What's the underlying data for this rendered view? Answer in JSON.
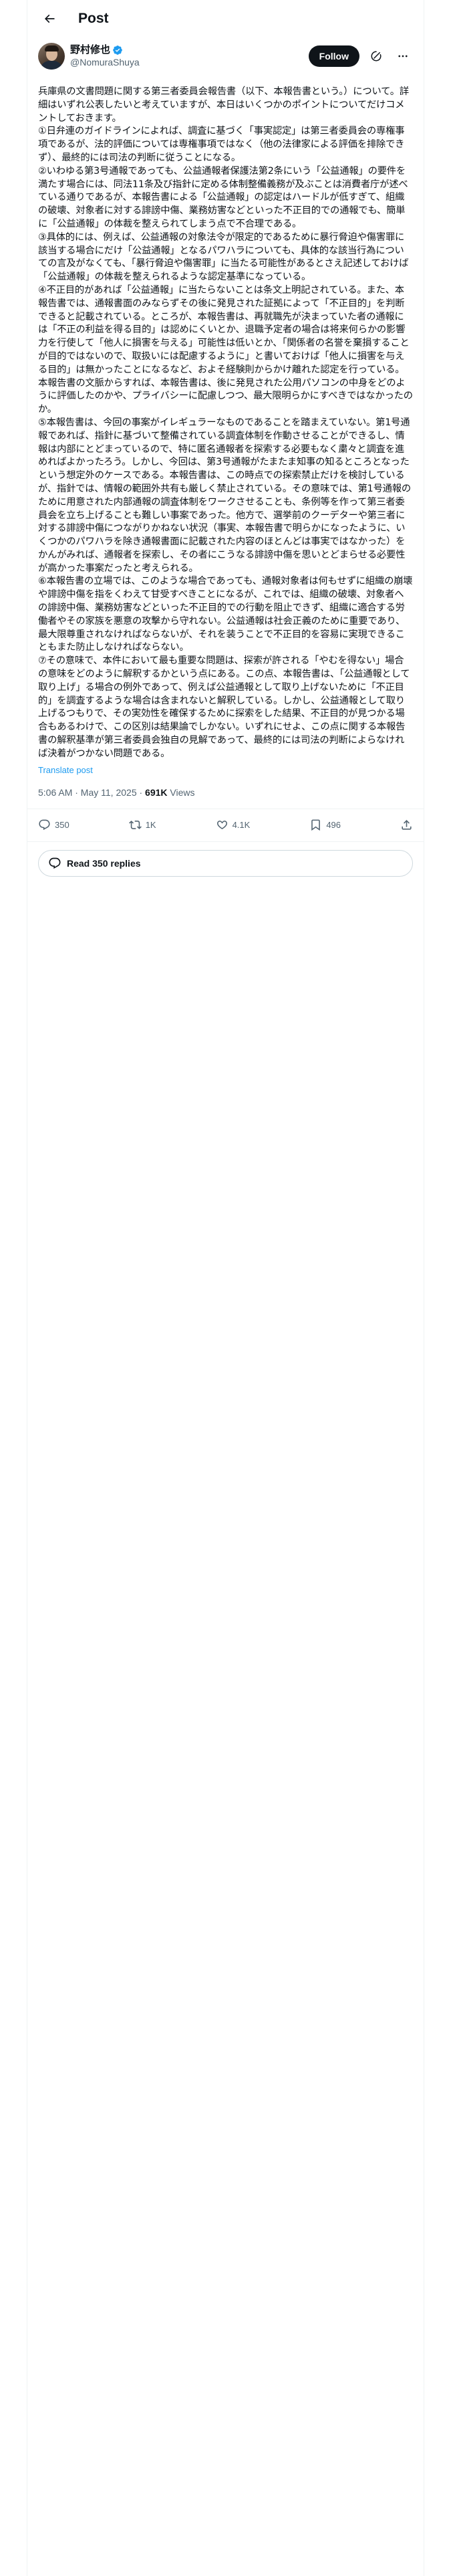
{
  "header": {
    "title": "Post"
  },
  "author": {
    "display_name": "野村修也",
    "handle": "@NomuraShuya",
    "follow_label": "Follow"
  },
  "post": {
    "text": "兵庫県の文書問題に関する第三者委員会報告書（以下、本報告書という。）について。詳細はいずれ公表したいと考えていますが、本日はいくつかのポイントについてだけコメントしておきます。\n①日弁連のガイドラインによれば、調査に基づく「事実認定」は第三者委員会の専権事項であるが、法的評価については専権事項ではなく（他の法律家による評価を排除できず）、最終的には司法の判断に従うことになる。\n②いわゆる第3号通報であっても、公益通報者保護法第2条にいう「公益通報」の要件を満たす場合には、同法11条及び指針に定める体制整備義務が及ぶことは消費者庁が述べている通りであるが、本報告書による「公益通報」の認定はハードルが低すぎて、組織の破壊、対象者に対する誹謗中傷、業務妨害などといった不正目的での通報でも、簡単に「公益通報」の体裁を整えられてしまう点で不合理である。\n③具体的には、例えば、公益通報の対象法令が限定的であるために暴行脅迫や傷害罪に該当する場合にだけ「公益通報」となるパワハラについても、具体的な該当行為についての言及がなくても、「暴行脅迫や傷害罪」に当たる可能性があるとさえ記述しておけば「公益通報」の体裁を整えられるような認定基準になっている。\n④不正目的があれば「公益通報」に当たらないことは条文上明記されている。また、本報告書では、通報書面のみならずその後に発見された証拠によって「不正目的」を判断できると記載されている。ところが、本報告書は、再就職先が決まっていた者の通報には「不正の利益を得る目的」は認めにくいとか、退職予定者の場合は将来何らかの影響力を行使して「他人に損害を与える」可能性は低いとか、「関係者の名誉を棄損することが目的ではないので、取扱いには配慮するように」と書いておけば「他人に損害を与える目的」は無かったことになるなど、およそ経験則からかけ離れた認定を行っている。本報告書の文脈からすれば、本報告書は、後に発見された公用パソコンの中身をどのように評価したのかや、プライバシーに配慮しつつ、最大限明らかにすべきではなかったのか。\n⑤本報告書は、今回の事案がイレギュラーなものであることを踏まえていない。第1号通報であれば、指針に基づいて整備されている調査体制を作動させることができるし、情報は内部にとどまっているので、特に匿名通報者を探索する必要もなく粛々と調査を進めればよかったろう。しかし、今回は、第3号通報がたまたま知事の知るところとなったという想定外のケースである。本報告書は、この時点での探索禁止だけを検討しているが、指針では、情報の範囲外共有も厳しく禁止されている。その意味では、第1号通報のために用意された内部通報の調査体制をワークさせることも、条例等を作って第三者委員会を立ち上げることも難しい事案であった。他方で、選挙前のクーデターや第三者に対する誹謗中傷につながりかねない状況（事実、本報告書で明らかになったように、いくつかのパワハラを除き通報書面に記載された内容のほとんどは事実ではなかった）をかんがみれば、通報者を探索し、その者にこうなる誹謗中傷を思いとどまらせる必要性が高かった事案だったと考えられる。\n⑥本報告書の立場では、このような場合であっても、通報対象者は何もせずに組織の崩壊や誹謗中傷を指をくわえて甘受すべきことになるが、これでは、組織の破壊、対象者への誹謗中傷、業務妨害などといった不正目的での行動を阻止できず、組織に適合する労働者やその家族を悪意の攻撃から守れない。公益通報は社会正義のために重要であり、最大限尊重されなければならないが、それを装うことで不正目的を容易に実現できることもまた防止しなければならない。\n⑦その意味で、本件において最も重要な問題は、探索が許される「やむを得ない」場合の意味をどのように解釈するかという点にある。この点、本報告書は、「公益通報として取り上げ」る場合の例外であって、例えば公益通報として取り上げないために「不正目的」を調査するような場合は含まれないと解釈している。しかし、公益通報として取り上げるつもりで、その実効性を確保するために探索をした結果、不正目的が見つかる場合もあるわけで、この区別は結果論でしかない。いずれにせよ、この点に関する本報告書の解釈基準が第三者委員会独自の見解であって、最終的には司法の判断によらなければ決着がつかない問題である。",
    "translate_label": "Translate post",
    "timestamp": "5:06 AM · May 11, 2025 · ",
    "views_count": "691K",
    "views_label": " Views"
  },
  "actions": {
    "replies": "350",
    "reposts": "1K",
    "likes": "4.1K",
    "bookmarks": "496"
  },
  "replies_button": {
    "label": "Read 350 replies"
  }
}
